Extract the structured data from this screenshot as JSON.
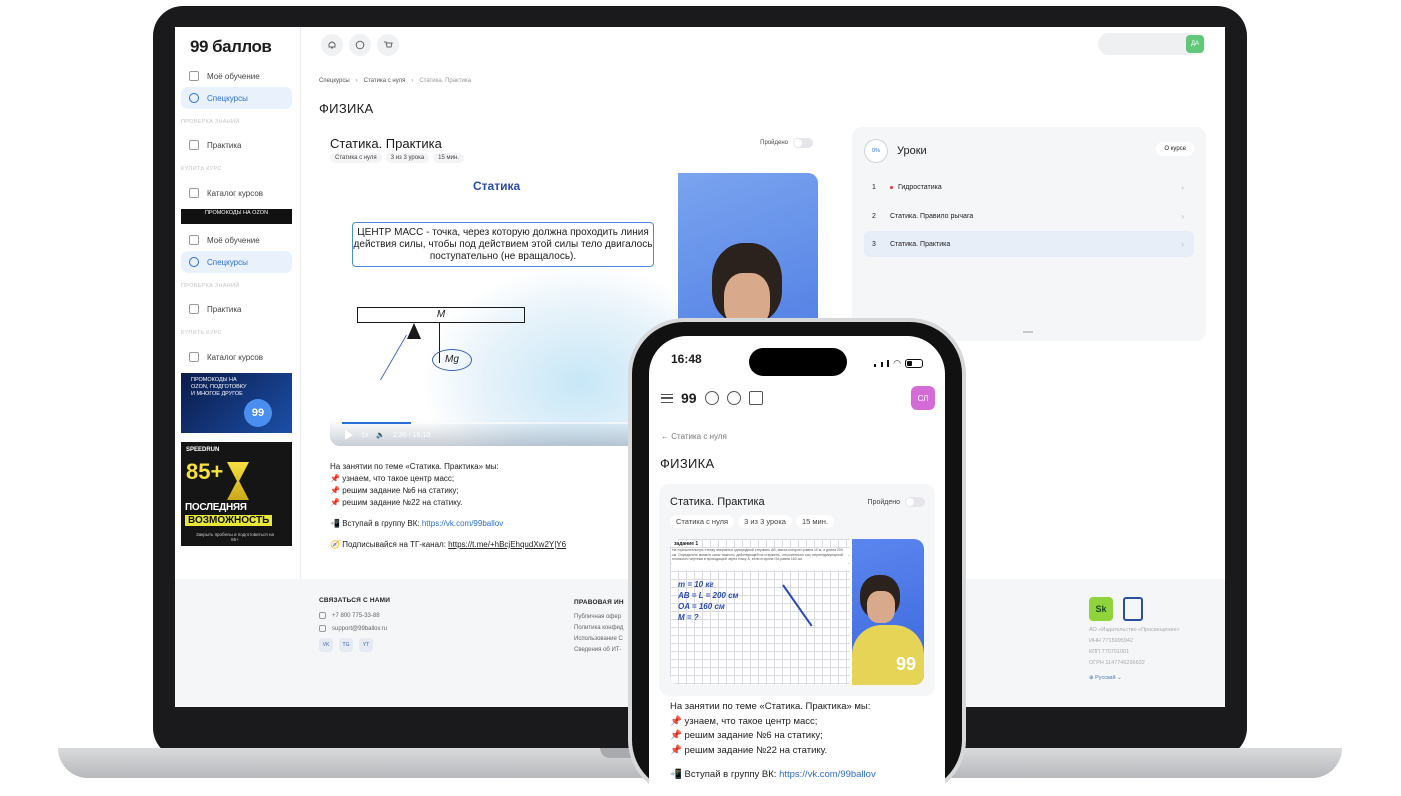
{
  "sidebar": {
    "logo": "99 баллов",
    "items_top": [
      {
        "label": "Моё обучение"
      },
      {
        "label": "Спецкурсы"
      }
    ],
    "section_check": "ПРОВЕРКА ЗНАНИЙ",
    "practice": "Практика",
    "section_buy": "КУПИТЬ КУРС",
    "catalog": "Каталог курсов",
    "promo_strip": "ПРОМОКОДЫ НА OZON",
    "items_repeat": [
      {
        "label": "Моё обучение"
      },
      {
        "label": "Спецкурсы"
      }
    ],
    "banner_ozon": "ПРОМОКОДЫ НА OZON, ПОДГОТОВКУ И МНОГОЕ ДРУГОЕ",
    "banner_speedrun": {
      "brand": "SPEEDRUN",
      "score": "85+",
      "line1": "ПОСЛЕДНЯЯ",
      "line2": "ВОЗМОЖНОСТЬ",
      "note": "Закрыть пробелы и подготовиться на 85+"
    }
  },
  "topbar": {
    "icons": [
      "bell-icon",
      "chat-icon",
      "cart-icon"
    ],
    "avatar": "ДА"
  },
  "breadcrumb": [
    "Спецкурсы",
    "Статика с нуля",
    "Статика. Практика"
  ],
  "page_title": "ФИЗИКА",
  "lesson": {
    "title": "Статика. Практика",
    "passed_label": "Пройдено",
    "chips": [
      "Статика с нуля",
      "3 из 3 урока",
      "15 мин."
    ],
    "progress": 0.23,
    "slide": {
      "title": "Статика",
      "definition": "ЦЕНТР МАСС - точка, через которую должна проходить линия действия силы, чтобы под действием этой силы тело двигалось поступательно (не вращалось).",
      "beam_label": "M",
      "force_label": "Mg"
    },
    "player": {
      "speed": "1x",
      "time": "2:36 / 16:10"
    },
    "description": {
      "intro": "На занятии по теме «Статика. Практика» мы:",
      "points": [
        "узнаем, что такое центр масс;",
        "решим задание №6 на статику;",
        "решим задание №22 на статику."
      ],
      "vk_prefix": "Вступай в группу ВК:",
      "vk_link": "https://vk.com/99ballov",
      "tg_prefix": "Подписывайся на ТГ-канал:",
      "tg_link": "https://t.me/+hBcjEhqudXw2Y|Y6"
    }
  },
  "lessons_panel": {
    "progress": "0%",
    "title": "Уроки",
    "about_button": "О курсе",
    "items": [
      {
        "num": "1",
        "label": "Гидростатика"
      },
      {
        "num": "2",
        "label": "Статика. Правило рычага"
      },
      {
        "num": "3",
        "label": "Статика. Практика"
      }
    ]
  },
  "footer": {
    "contacts_title": "СВЯЗАТЬСЯ С НАМИ",
    "phone": "+7 800 775-33-88",
    "email": "support@99ballov.ru",
    "socials": [
      "VK",
      "TG",
      "YT"
    ],
    "legal_title": "ПРАВОВАЯ ИН",
    "legal_items": [
      "Публичная офер",
      "Политика конфид",
      "Использование С",
      "Сведения об ИТ-"
    ],
    "brand_lines": [
      "АО «Издательство «Просвещение»",
      "ИНН 7715995942",
      "КПП 770701001",
      "ОГРН 1147746296632"
    ],
    "language": "Русский"
  },
  "phone": {
    "time": "16:48",
    "logo": "99",
    "avatar": "СЛ",
    "back_label": "Статика с нуля",
    "page_title": "ФИЗИКА",
    "card_title": "Статика. Практика",
    "passed_label": "Пройдено",
    "chips": [
      "Статика с нуля",
      "3 из 3 урока",
      "15 мин."
    ],
    "task_title": "задание 1",
    "task_text": "На горизонтальную стенку опирается однородный стержень AB, масса которого равна 10 кг, а длина 200 см. Определите момент силы тяжести, действующей на стержень, относительно оси, перпендикулярной плоскости чертежа и проходящей через точку A, если сторона OA равна 160 см.",
    "description": {
      "intro": "На занятии по теме «Статика. Практика» мы:",
      "points": [
        "узнаем, что такое центр масс;",
        "решим задание №6 на статику;",
        "решим задание №22 на статику."
      ],
      "vk_prefix": "Вступай в группу ВК:",
      "vk_link": "https://vk.com/99ballov"
    }
  },
  "colors": {
    "accent": "#2a6fd6",
    "avatar_laptop": "#61c77a",
    "avatar_phone": "#d56bd6"
  }
}
